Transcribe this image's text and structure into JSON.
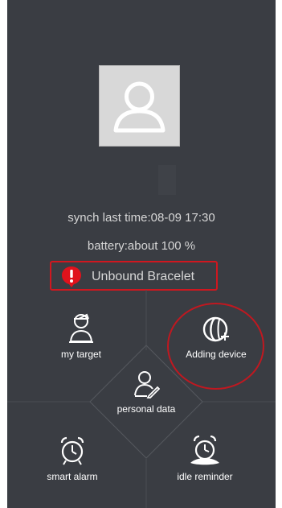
{
  "profile": {
    "sync_text": "synch last time:08-09 17:30",
    "battery_text": "battery:about 100 %"
  },
  "bracelet": {
    "status_text": "Unbound Bracelet"
  },
  "menu": {
    "my_target": "my target",
    "adding_device": "Adding device",
    "personal_data": "personal data",
    "smart_alarm": "smart alarm",
    "idle_reminder": "idle reminder"
  },
  "colors": {
    "background": "#3a3d43",
    "alert_red": "#d0171f",
    "text": "#d6d6d6"
  },
  "icons": [
    "avatar-icon",
    "alert-icon",
    "target-icon",
    "add-device-icon",
    "personal-data-icon",
    "alarm-clock-icon",
    "idle-alarm-icon"
  ]
}
